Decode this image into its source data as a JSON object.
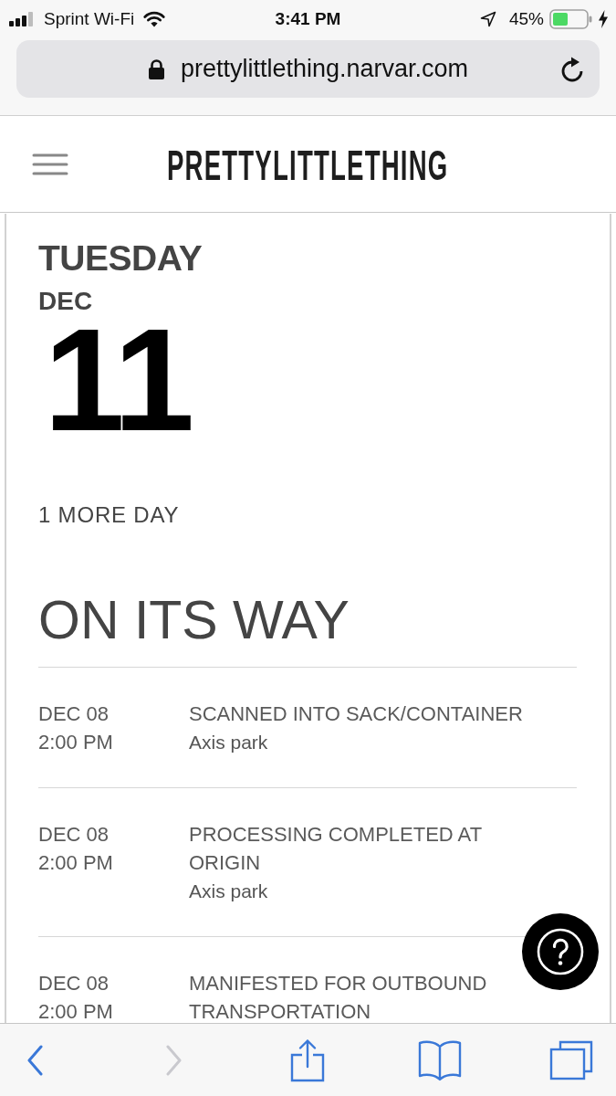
{
  "status_bar": {
    "carrier": "Sprint Wi-Fi",
    "time": "3:41 PM",
    "battery": "45%"
  },
  "browser_bar": {
    "url": "prettylittlething.narvar.com"
  },
  "header": {
    "logo": "PRETTYLITTLETHING"
  },
  "delivery": {
    "weekday": "TUESDAY",
    "month": "DEC",
    "day": "11",
    "countdown": "1 MORE DAY"
  },
  "tracking": {
    "status": "ON ITS WAY",
    "events": [
      {
        "date": "DEC 08",
        "time": "2:00 PM",
        "description": "SCANNED INTO SACK/CONTAINER",
        "location": "Axis park"
      },
      {
        "date": "DEC 08",
        "time": "2:00 PM",
        "description": "PROCESSING COMPLETED AT ORIGIN",
        "location": "Axis park"
      },
      {
        "date": "DEC 08",
        "time": "2:00 PM",
        "description": "MANIFESTED FOR OUTBOUND TRANSPORTATION"
      }
    ]
  },
  "toolbar": {
    "buttons": [
      {
        "kind": "back",
        "disabled": false
      },
      {
        "kind": "forward",
        "disabled": true
      },
      {
        "kind": "share",
        "disabled": false
      },
      {
        "kind": "bookmarks",
        "disabled": false
      },
      {
        "kind": "tabs",
        "disabled": false
      }
    ]
  }
}
